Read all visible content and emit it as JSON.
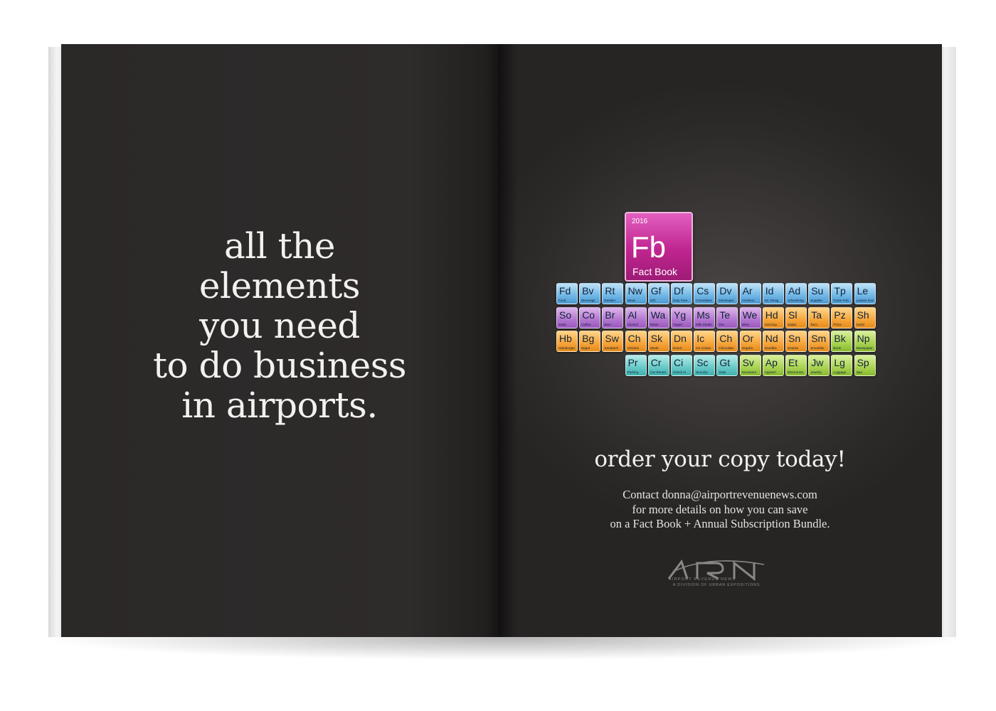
{
  "left_page": {
    "headline_lines": [
      "all the",
      "elements",
      "you need",
      "to do business",
      "in airports."
    ]
  },
  "right_page": {
    "featured_element": {
      "year": "2016",
      "symbol": "Fb",
      "name": "Fact Book",
      "color": "#c0258f"
    },
    "elements_rows": [
      [
        {
          "s": "Fd",
          "n": "Food",
          "c": "blue"
        },
        {
          "s": "Bv",
          "n": "Beverage",
          "c": "blue"
        },
        {
          "s": "Rt",
          "n": "Retailer",
          "c": "blue"
        },
        {
          "s": "Nw",
          "n": "News",
          "c": "blue"
        },
        {
          "s": "Gf",
          "n": "Gift",
          "c": "blue"
        },
        {
          "s": "Df",
          "n": "Duty Free",
          "c": "blue"
        },
        {
          "s": "Cs",
          "n": "Consultant",
          "c": "blue"
        },
        {
          "s": "Dv",
          "n": "Developer",
          "c": "blue"
        },
        {
          "s": "Ar",
          "n": "Architect",
          "c": "blue"
        },
        {
          "s": "Id",
          "n": "Int. Desig.",
          "c": "blue"
        },
        {
          "s": "Ad",
          "n": "Advertising",
          "c": "blue"
        },
        {
          "s": "Su",
          "n": "Supplier",
          "c": "blue"
        },
        {
          "s": "Tp",
          "n": "Trade Pub.",
          "c": "blue"
        },
        {
          "s": "Le",
          "n": "Leases Due",
          "c": "blue"
        }
      ],
      [
        {
          "s": "So",
          "n": "Soda",
          "c": "violet"
        },
        {
          "s": "Co",
          "n": "Coffee",
          "c": "violet"
        },
        {
          "s": "Br",
          "n": "Beer",
          "c": "violet"
        },
        {
          "s": "Al",
          "n": "Alcohol",
          "c": "violet"
        },
        {
          "s": "Wa",
          "n": "Water",
          "c": "violet"
        },
        {
          "s": "Yg",
          "n": "Yogurt",
          "c": "violet"
        },
        {
          "s": "Ms",
          "n": "Milk Shake",
          "c": "violet"
        },
        {
          "s": "Te",
          "n": "Tea",
          "c": "violet"
        },
        {
          "s": "We",
          "n": "Wine",
          "c": "violet"
        },
        {
          "s": "Hd",
          "n": "Hot Dog",
          "c": "orange"
        },
        {
          "s": "Sl",
          "n": "Salad",
          "c": "orange"
        },
        {
          "s": "Ta",
          "n": "Taco",
          "c": "orange"
        },
        {
          "s": "Pz",
          "n": "Pizza",
          "c": "orange"
        },
        {
          "s": "Sh",
          "n": "Sushi",
          "c": "orange"
        }
      ],
      [
        {
          "s": "Hb",
          "n": "Hamburger",
          "c": "orange"
        },
        {
          "s": "Bg",
          "n": "Bagel",
          "c": "orange"
        },
        {
          "s": "Sw",
          "n": "Sandwich",
          "c": "orange"
        },
        {
          "s": "Ch",
          "n": "Chicken",
          "c": "orange"
        },
        {
          "s": "Sk",
          "n": "Steak",
          "c": "orange"
        },
        {
          "s": "Dn",
          "n": "Donut",
          "c": "orange"
        },
        {
          "s": "Ic",
          "n": "Ice Cream",
          "c": "orange"
        },
        {
          "s": "Ch",
          "n": "Chocolate",
          "c": "orange"
        },
        {
          "s": "Or",
          "n": "Organic",
          "c": "orange"
        },
        {
          "s": "Nd",
          "n": "Noodles",
          "c": "orange"
        },
        {
          "s": "Sn",
          "n": "Snacks",
          "c": "orange"
        },
        {
          "s": "Sm",
          "n": "Smoothie",
          "c": "orange"
        },
        {
          "s": "Bk",
          "n": "Book",
          "c": "green"
        },
        {
          "s": "Np",
          "n": "Newspaper",
          "c": "green"
        }
      ],
      [
        {
          "s": "Pr",
          "n": "Parking",
          "c": "teal"
        },
        {
          "s": "Cr",
          "n": "Car Rental",
          "c": "teal"
        },
        {
          "s": "Ci",
          "n": "Check In",
          "c": "teal"
        },
        {
          "s": "Sc",
          "n": "Security",
          "c": "teal"
        },
        {
          "s": "Gt",
          "n": "Gate",
          "c": "teal"
        },
        {
          "s": "Sv",
          "n": "Souvenirs",
          "c": "green"
        },
        {
          "s": "Ap",
          "n": "Apparel",
          "c": "green"
        },
        {
          "s": "Et",
          "n": "Electronics",
          "c": "green"
        },
        {
          "s": "Jw",
          "n": "Jewelry",
          "c": "green"
        },
        {
          "s": "Lg",
          "n": "Luggage",
          "c": "green"
        },
        {
          "s": "Sp",
          "n": "Spa",
          "c": "green"
        }
      ]
    ],
    "cta": "order your copy today!",
    "contact_lines": [
      "Contact donna@airportrevenuenews.com",
      "for more details on how you can save",
      "on a Fact Book + Annual Subscription Bundle."
    ],
    "logo": {
      "wordmark": "ARN",
      "tagline": "AIRPORT REVENUE NEWS",
      "subtagline": "A DIVISION OF URBAN EXPOSITIONS"
    }
  }
}
